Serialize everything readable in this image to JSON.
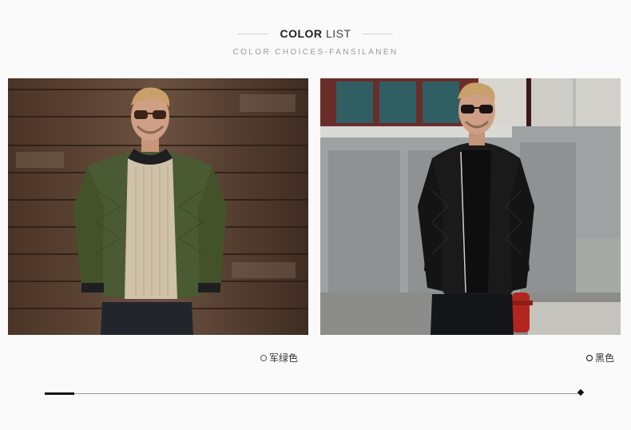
{
  "header": {
    "title_bold": "COLOR",
    "title_light": "LIST",
    "subtitle": "COLOR CHOICES-FANSILANEN"
  },
  "products": [
    {
      "caption": "军绿色",
      "color": "#4a5a32"
    },
    {
      "caption": "黑色",
      "color": "#1a1a1a"
    }
  ],
  "slider": {
    "progress": 0.055
  }
}
